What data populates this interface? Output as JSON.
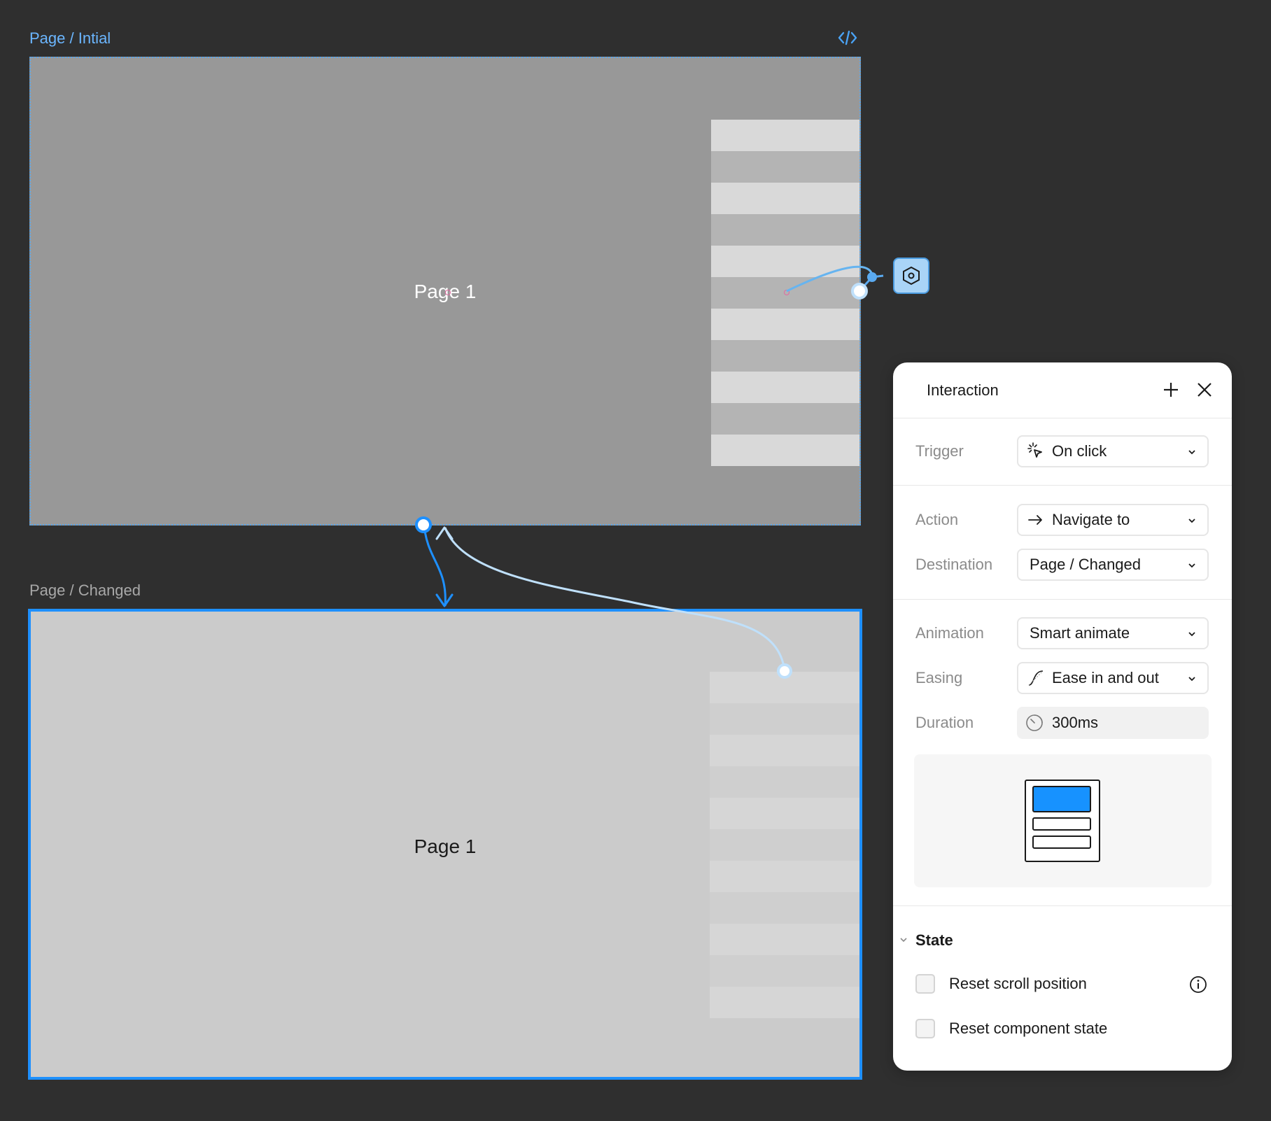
{
  "frames": {
    "initial": {
      "label": "Page / Intial",
      "title": "Page 1"
    },
    "changed": {
      "label": "Page / Changed",
      "title": "Page 1"
    }
  },
  "toolbar": {
    "code_icon": "code-icon"
  },
  "panel": {
    "title": "Interaction",
    "trigger": {
      "label": "Trigger",
      "value": "On click",
      "icon": "click-icon"
    },
    "action": {
      "label": "Action",
      "value": "Navigate to",
      "icon": "arrow-right-icon"
    },
    "destination": {
      "label": "Destination",
      "value": "Page / Changed"
    },
    "animation": {
      "label": "Animation",
      "value": "Smart animate"
    },
    "easing": {
      "label": "Easing",
      "value": "Ease in and out",
      "icon": "easing-curve-icon"
    },
    "duration": {
      "label": "Duration",
      "value": "300ms",
      "icon": "timer-icon"
    },
    "state": {
      "heading": "State",
      "reset_scroll": {
        "label": "Reset scroll position",
        "checked": false
      },
      "reset_component": {
        "label": "Reset component state",
        "checked": false
      }
    }
  },
  "colors": {
    "canvas": "#2f2f2f",
    "accent": "#1e90ff",
    "connector_light": "#bfe0fb",
    "frame_initial_bg": "#989898",
    "frame_changed_bg": "#cbcbcb"
  }
}
